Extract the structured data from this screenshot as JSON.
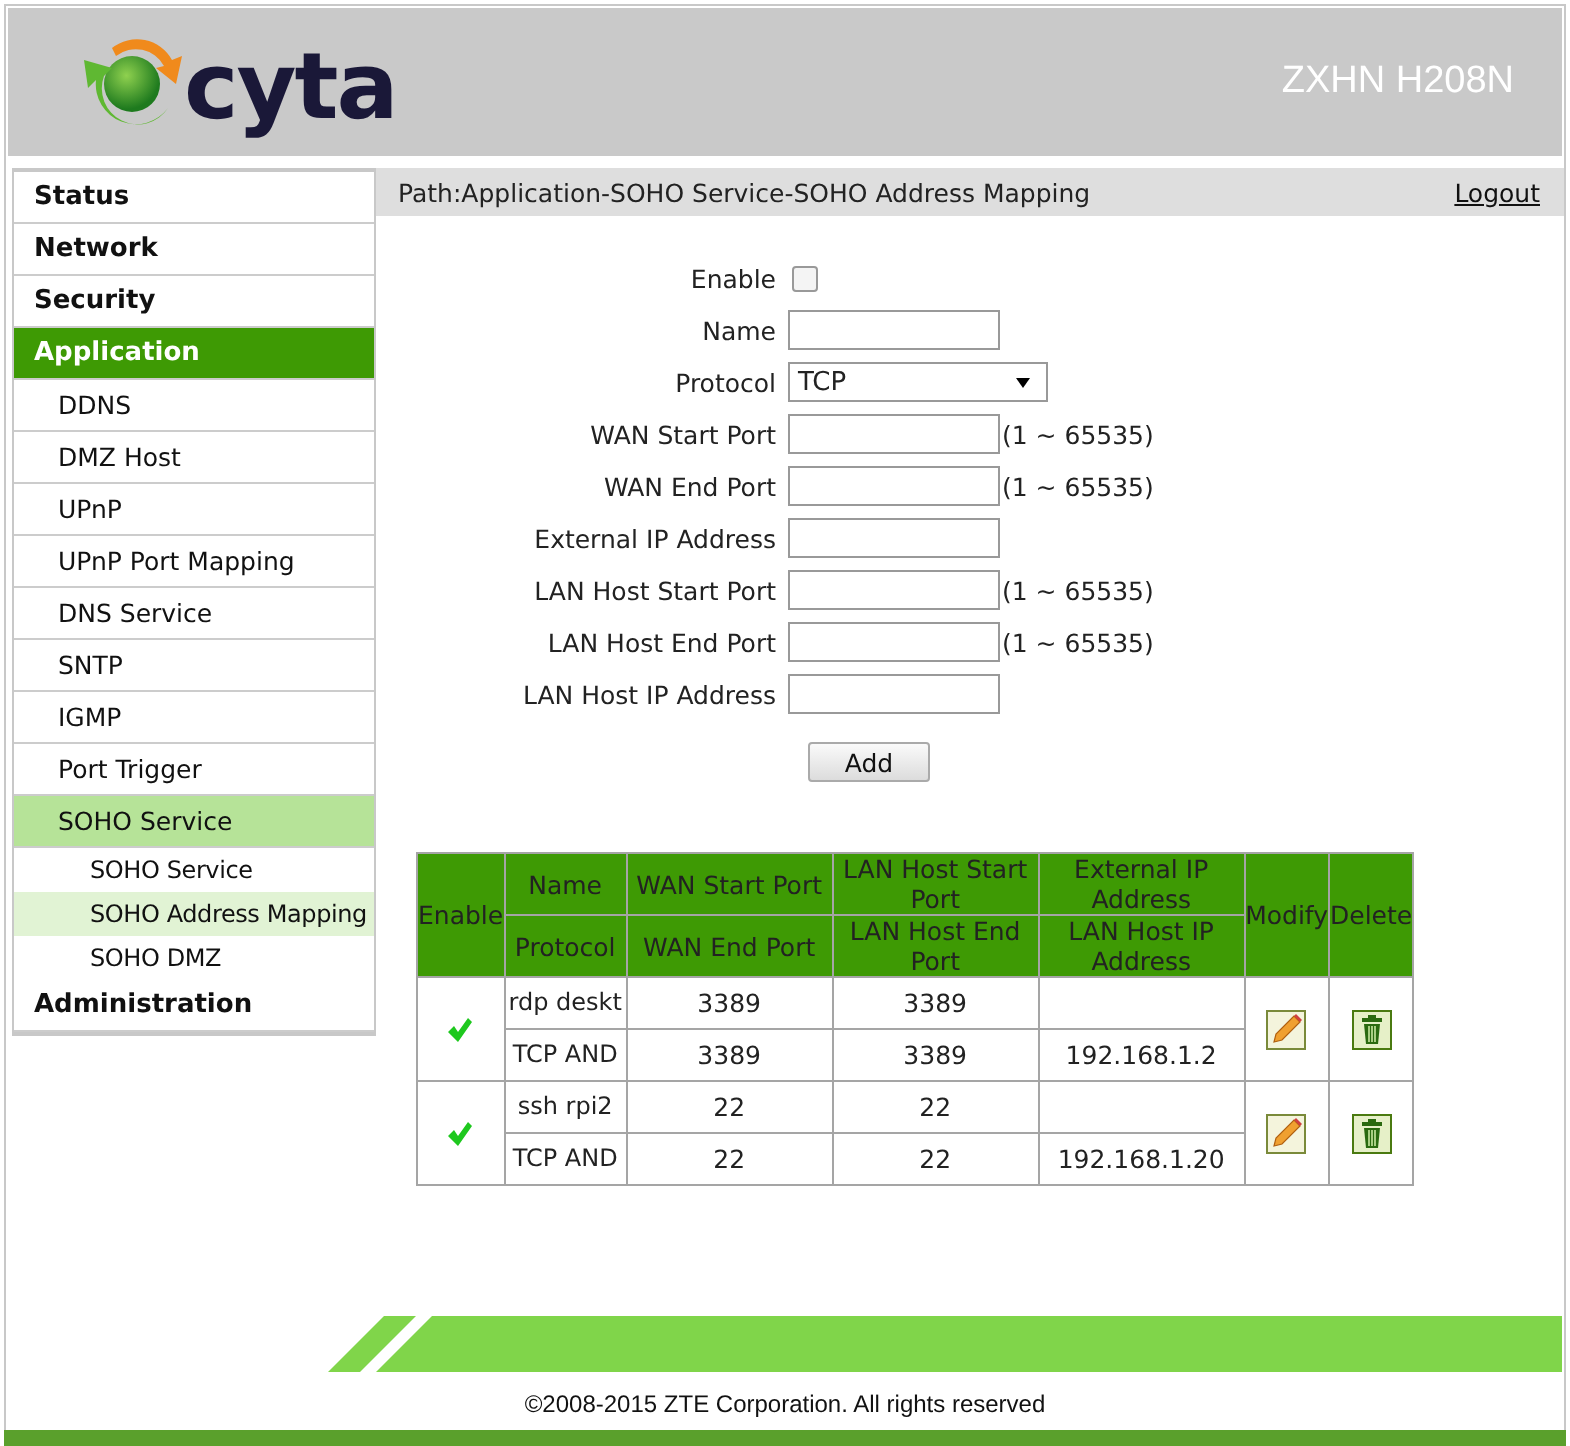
{
  "header": {
    "logo_text": "cyta",
    "model": "ZXHN H208N"
  },
  "path": "Path:Application-SOHO Service-SOHO Address Mapping",
  "logout": "Logout",
  "sidebar": {
    "items": [
      {
        "label": "Status",
        "selected": false
      },
      {
        "label": "Network",
        "selected": false
      },
      {
        "label": "Security",
        "selected": false
      },
      {
        "label": "Application",
        "selected": true,
        "children": [
          {
            "label": "DDNS",
            "selected": false
          },
          {
            "label": "DMZ Host",
            "selected": false
          },
          {
            "label": "UPnP",
            "selected": false
          },
          {
            "label": "UPnP Port Mapping",
            "selected": false
          },
          {
            "label": "DNS Service",
            "selected": false
          },
          {
            "label": "SNTP",
            "selected": false
          },
          {
            "label": "IGMP",
            "selected": false
          },
          {
            "label": "Port Trigger",
            "selected": false
          },
          {
            "label": "SOHO Service",
            "selected": true,
            "children": [
              {
                "label": "SOHO Service",
                "selected": false
              },
              {
                "label": "SOHO Address Mapping",
                "selected": true
              },
              {
                "label": "SOHO DMZ",
                "selected": false
              }
            ]
          }
        ]
      },
      {
        "label": "Administration",
        "selected": false
      }
    ]
  },
  "form": {
    "fields": [
      {
        "kind": "checkbox",
        "label": "Enable",
        "checked": false
      },
      {
        "kind": "text",
        "label": "Name"
      },
      {
        "kind": "select",
        "label": "Protocol",
        "value": "TCP"
      },
      {
        "kind": "text",
        "label": "WAN Start Port",
        "hint": "(1 ~ 65535)"
      },
      {
        "kind": "text",
        "label": "WAN End Port",
        "hint": "(1 ~ 65535)"
      },
      {
        "kind": "text",
        "label": "External IP Address"
      },
      {
        "kind": "text",
        "label": "LAN Host Start Port",
        "hint": "(1 ~ 65535)"
      },
      {
        "kind": "text",
        "label": "LAN Host End Port",
        "hint": "(1 ~ 65535)"
      },
      {
        "kind": "text",
        "label": "LAN Host IP Address"
      }
    ],
    "add_button": "Add"
  },
  "table": {
    "columns": {
      "enable": "Enable",
      "name": "Name",
      "protocol": "Protocol",
      "wan_start": "WAN Start Port",
      "wan_end": "WAN End Port",
      "lan_start": "LAN Host Start Port",
      "lan_end": "LAN Host End Port",
      "external_ip": "External IP Address",
      "lan_ip": "LAN Host IP Address",
      "modify": "Modify",
      "delete": "Delete"
    },
    "rows": [
      {
        "enabled": true,
        "name": "rdp deskt",
        "protocol": "TCP AND",
        "wan_start": "3389",
        "wan_end": "3389",
        "lan_start": "3389",
        "lan_end": "3389",
        "external_ip": "",
        "lan_ip": "192.168.1.2"
      },
      {
        "enabled": true,
        "name": "ssh rpi2",
        "protocol": "TCP AND",
        "wan_start": "22",
        "wan_end": "22",
        "lan_start": "22",
        "lan_end": "22",
        "external_ip": "",
        "lan_ip": "192.168.1.20"
      }
    ]
  },
  "footer": {
    "copyright": "©2008-2015 ZTE Corporation. All rights reserved"
  }
}
